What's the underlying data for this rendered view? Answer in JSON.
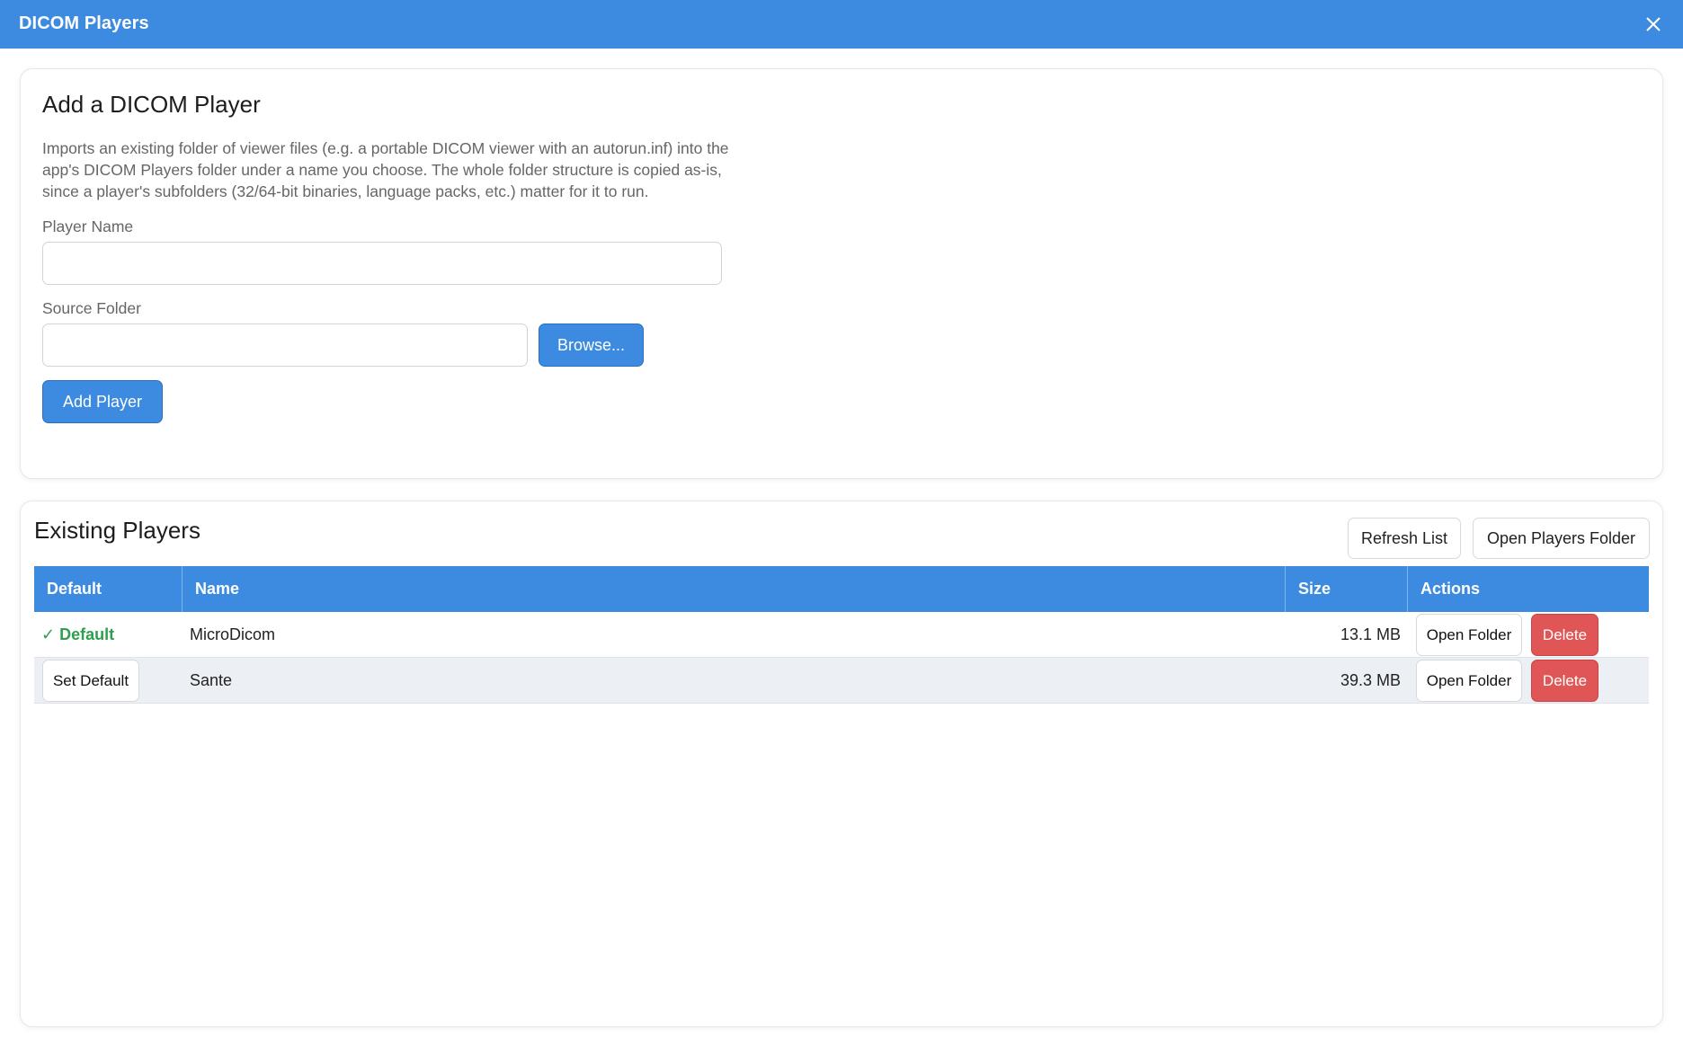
{
  "window": {
    "title": "DICOM Players"
  },
  "add_section": {
    "heading": "Add a DICOM Player",
    "description": "Imports an existing folder of viewer files (e.g. a portable DICOM viewer with an autorun.inf) into the app's DICOM Players folder under a name you choose. The whole folder structure is copied as-is, since a player's subfolders (32/64-bit binaries, language packs, etc.) matter for it to run.",
    "player_name_label": "Player Name",
    "player_name_value": "",
    "source_folder_label": "Source Folder",
    "source_folder_value": "",
    "browse_label": "Browse...",
    "add_label": "Add Player"
  },
  "existing_section": {
    "heading": "Existing Players",
    "refresh_label": "Refresh List",
    "open_folder_label": "Open Players Folder",
    "columns": [
      "Default",
      "Name",
      "Size",
      "Actions"
    ],
    "rows": [
      {
        "default": "✓ Default",
        "is_default": true,
        "name": "MicroDicom",
        "size": "13.1 MB",
        "open_label": "Open Folder",
        "delete_label": "Delete"
      },
      {
        "default": "Set Default",
        "is_default": false,
        "name": "Sante",
        "size": "39.3 MB",
        "open_label": "Open Folder",
        "delete_label": "Delete"
      }
    ]
  },
  "colors": {
    "accent": "#3d8be0",
    "danger": "#e05555",
    "success": "#2f9e4f"
  },
  "icons": {
    "close": "close-icon"
  }
}
